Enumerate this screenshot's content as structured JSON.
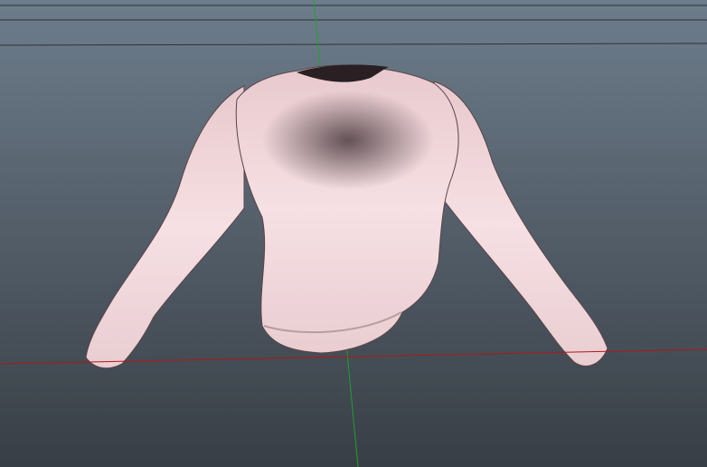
{
  "viewport": {
    "background_top": "#6d7d8c",
    "background_bottom": "#383e45",
    "grid_color": "#2e3237",
    "x_axis_color": "#b01818",
    "y_axis_color": "#1fa030",
    "model": {
      "type": "sweater",
      "base_color": "#f3d9dc",
      "shadow_color": "#3a2a2e"
    }
  }
}
